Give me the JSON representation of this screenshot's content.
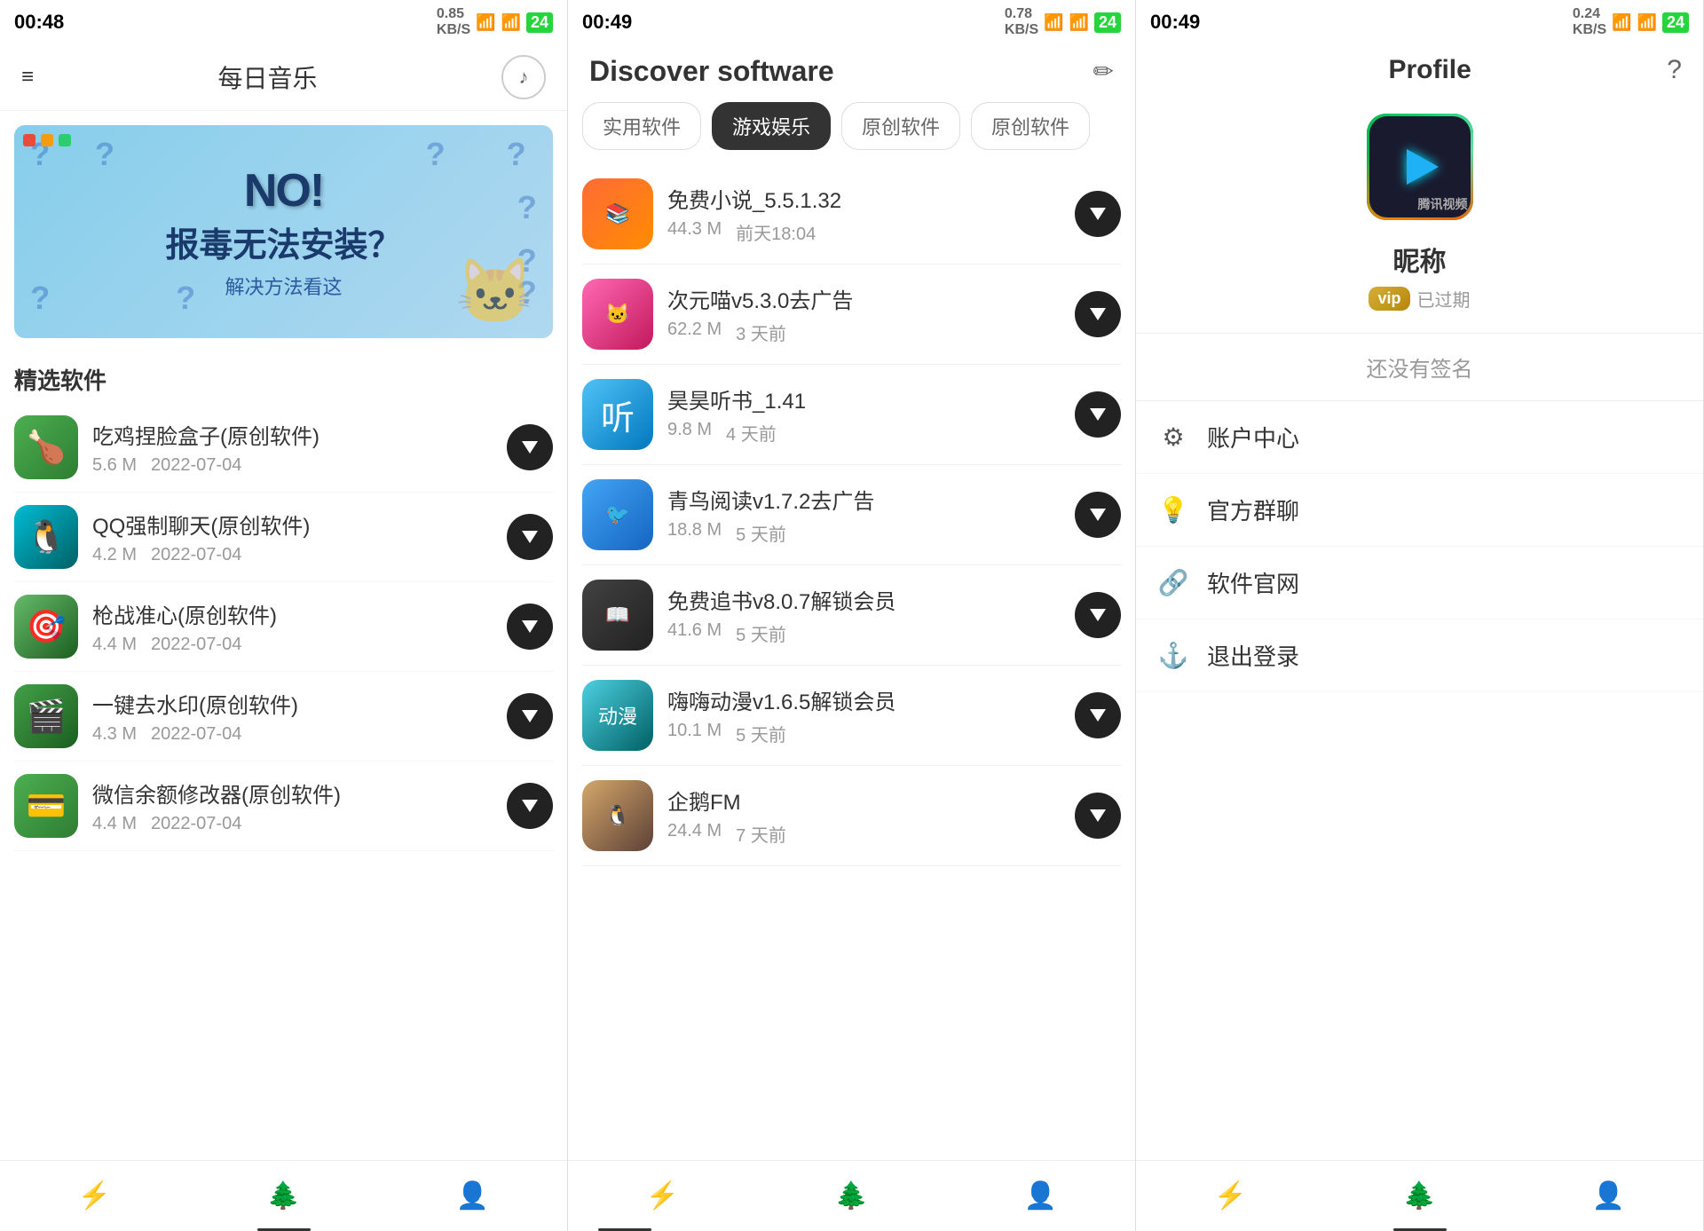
{
  "panels": {
    "panel1": {
      "status_time": "00:48",
      "header_title": "每日音乐",
      "menu_icon": "≡",
      "music_icon": "♪",
      "banner": {
        "no_text": "NO!",
        "main_text": "报毒无法安装？",
        "sub_text": "解决方法看这",
        "dots": [
          "red",
          "yellow",
          "green"
        ]
      },
      "section_title": "精选软件",
      "apps": [
        {
          "name": "吃鸡捏脸盒子(原创软件)",
          "size": "5.6 M",
          "date": "2022-07-04",
          "color": "green"
        },
        {
          "name": "QQ强制聊天(原创软件)",
          "size": "4.2 M",
          "date": "2022-07-04",
          "color": "teal"
        },
        {
          "name": "枪战准心(原创软件)",
          "size": "4.4 M",
          "date": "2022-07-04",
          "color": "green2"
        },
        {
          "name": "一键去水印(原创软件)",
          "size": "4.3 M",
          "date": "2022-07-04",
          "color": "green3"
        },
        {
          "name": "微信余额修改器(原创软件)",
          "size": "4.4 M",
          "date": "2022-07-04",
          "color": "green4"
        }
      ],
      "nav": {
        "items": [
          "⚡",
          "🌲",
          "👤"
        ],
        "active_index": 1
      }
    },
    "panel2": {
      "status_time": "00:49",
      "header_title": "Discover software",
      "categories": [
        {
          "label": "实用软件",
          "active": false
        },
        {
          "label": "游戏娱乐",
          "active": true
        },
        {
          "label": "原创软件",
          "active": false
        },
        {
          "label": "原创软件",
          "active": false
        }
      ],
      "software": [
        {
          "name": "免费小说_5.5.1.32",
          "size": "44.3 M",
          "time": "前天18:04",
          "color": "orange",
          "icon_text": "📚"
        },
        {
          "name": "次元喵v5.3.0去广告",
          "size": "62.2 M",
          "time": "3 天前",
          "color": "pink",
          "icon_text": "🐱"
        },
        {
          "name": "昊昊听书_1.41",
          "size": "9.8 M",
          "time": "4 天前",
          "color": "teal2",
          "icon_text": "听"
        },
        {
          "name": "青鸟阅读v1.7.2去广告",
          "size": "18.8 M",
          "time": "5 天前",
          "color": "blue",
          "icon_text": "🐦"
        },
        {
          "name": "免费追书v8.0.7解锁会员",
          "size": "41.6 M",
          "time": "5 天前",
          "color": "dark",
          "icon_text": "📖"
        },
        {
          "name": "嗨嗨动漫v1.6.5解锁会员",
          "size": "10.1 M",
          "time": "5 天前",
          "color": "cyan",
          "icon_text": "动漫"
        },
        {
          "name": "企鹅FM",
          "size": "24.4 M",
          "time": "7 天前",
          "color": "tan",
          "icon_text": "🐧"
        }
      ],
      "nav": {
        "items": [
          "⚡",
          "🌲",
          "👤"
        ],
        "active_index": 0
      }
    },
    "panel3": {
      "status_time": "00:49",
      "header_title": "Profile",
      "nickname": "昵称",
      "vip_label": "vip",
      "expired_text": "已过期",
      "no_signature": "还没有签名",
      "menu_items": [
        {
          "icon": "⚙",
          "label": "账户中心"
        },
        {
          "icon": "💡",
          "label": "官方群聊"
        },
        {
          "icon": "🔗",
          "label": "软件官网"
        },
        {
          "icon": "⚓",
          "label": "退出登录"
        }
      ],
      "nav": {
        "items": [
          "⚡",
          "🌲",
          "👤"
        ],
        "active_index": 2
      }
    }
  }
}
